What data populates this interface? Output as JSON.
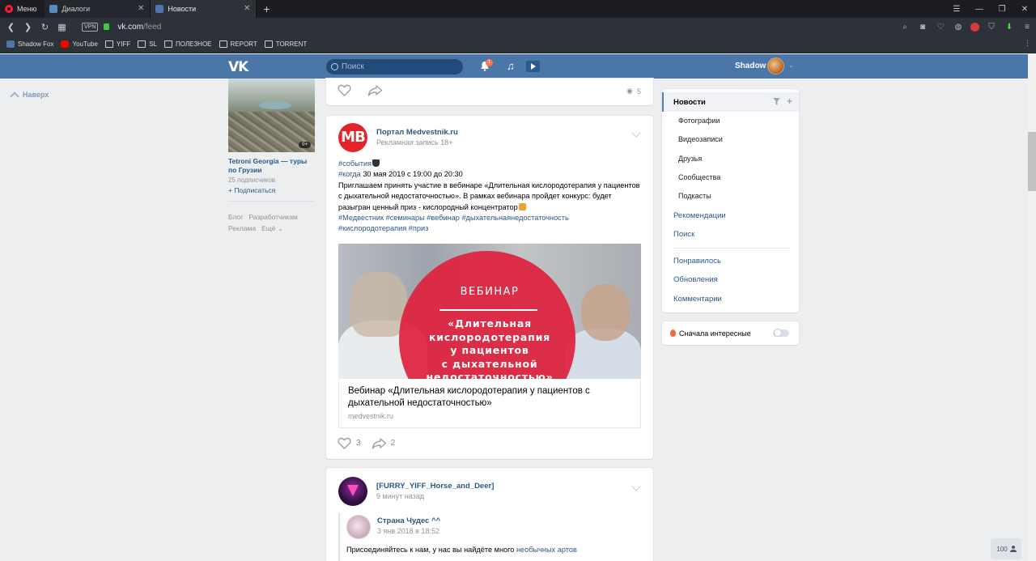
{
  "browser": {
    "menu_label": "Меню",
    "tabs": [
      {
        "label": "Диалоги"
      },
      {
        "label": "Новости"
      }
    ],
    "new_tab": "+",
    "vpn_label": "VPN",
    "url_host": "vk.com",
    "url_path": "/feed",
    "bookmarks": [
      {
        "label": "Shadow Fox",
        "icon": "vk-icon"
      },
      {
        "label": "YouTube",
        "icon": "youtube-icon"
      },
      {
        "label": "YIFF",
        "icon": "folder-icon"
      },
      {
        "label": "SL",
        "icon": "folder-icon"
      },
      {
        "label": "ПОЛЕЗНОЕ",
        "icon": "folder-icon"
      },
      {
        "label": "REPORT",
        "icon": "folder-icon"
      },
      {
        "label": "TORRENT",
        "icon": "folder-icon"
      }
    ]
  },
  "header": {
    "logo": "VK",
    "search_placeholder": "Поиск",
    "notifications_count": "1",
    "user_name": "Shadow"
  },
  "left": {
    "to_top": "Наверх",
    "ad": {
      "age": "0+",
      "title": "Tetroni Georgia — туры по Грузии",
      "subscribers": "25 подписчиков",
      "subscribe": "+ Подписаться"
    },
    "footer": {
      "blog": "Блог",
      "developers": "Разработчикам",
      "ads": "Реклама",
      "more": "Ещё ⌄"
    }
  },
  "feed": {
    "post_top": {
      "views": "5"
    },
    "post_ad": {
      "avatar_text": "MB",
      "author": "Портал Medvestnik.ru",
      "meta": "Рекламная запись 18+",
      "tag_events": "#события",
      "tag_when": "#когда",
      "date_text": " 30 мая 2019 с 19:00 до 20:30",
      "body": "Приглашаем принять участие в вебинаре «Длительная кислородотерапия у пациентов с дыхательной недостаточностью». В рамках вебинара пройдет конкурс: будет разыгран ценный приз - кислородный концентратор",
      "tags_line1": "#Медвестник #семинары #вебинар #дыхательнаянедостаточность",
      "tags_line2": "#кислородотерапия #приз",
      "image_label": "ВЕБИНАР",
      "image_title_1": "«Длительная",
      "image_title_2": "кислородотерапия",
      "image_title_3": "у пациентов",
      "image_title_4": "с дыхательной",
      "image_title_5": "недостаточностью»",
      "link_title": "Вебинар «Длительная кислородотерапия у пациентов с дыхательной недостаточностью»",
      "link_domain": "medvestnik.ru",
      "likes": "3",
      "shares": "2"
    },
    "post_furry": {
      "author": "[FURRY_YIFF_Horse_and_Deer]",
      "meta": "9 минут назад",
      "repost_author": "Страна Чудес ^^",
      "repost_meta": "3 янв 2018 в 18:52",
      "text": "Присоединяйтесь к нам, у нас вы найдёте много ",
      "text_link": "необычных артов"
    }
  },
  "right_menu": {
    "items": [
      {
        "label": "Новости"
      },
      {
        "label": "Фотографии"
      },
      {
        "label": "Видеозаписи"
      },
      {
        "label": "Друзья"
      },
      {
        "label": "Сообщества"
      },
      {
        "label": "Подкасты"
      },
      {
        "label": "Рекомендации"
      },
      {
        "label": "Поиск"
      },
      {
        "label": "Понравилось"
      },
      {
        "label": "Обновления"
      },
      {
        "label": "Комментарии"
      }
    ],
    "interesting_first": "Сначала интересные"
  },
  "online_counter": "100",
  "colors": {
    "vk_blue": "#4a76a8",
    "link": "#2a5885",
    "accent_red": "#de213e"
  }
}
